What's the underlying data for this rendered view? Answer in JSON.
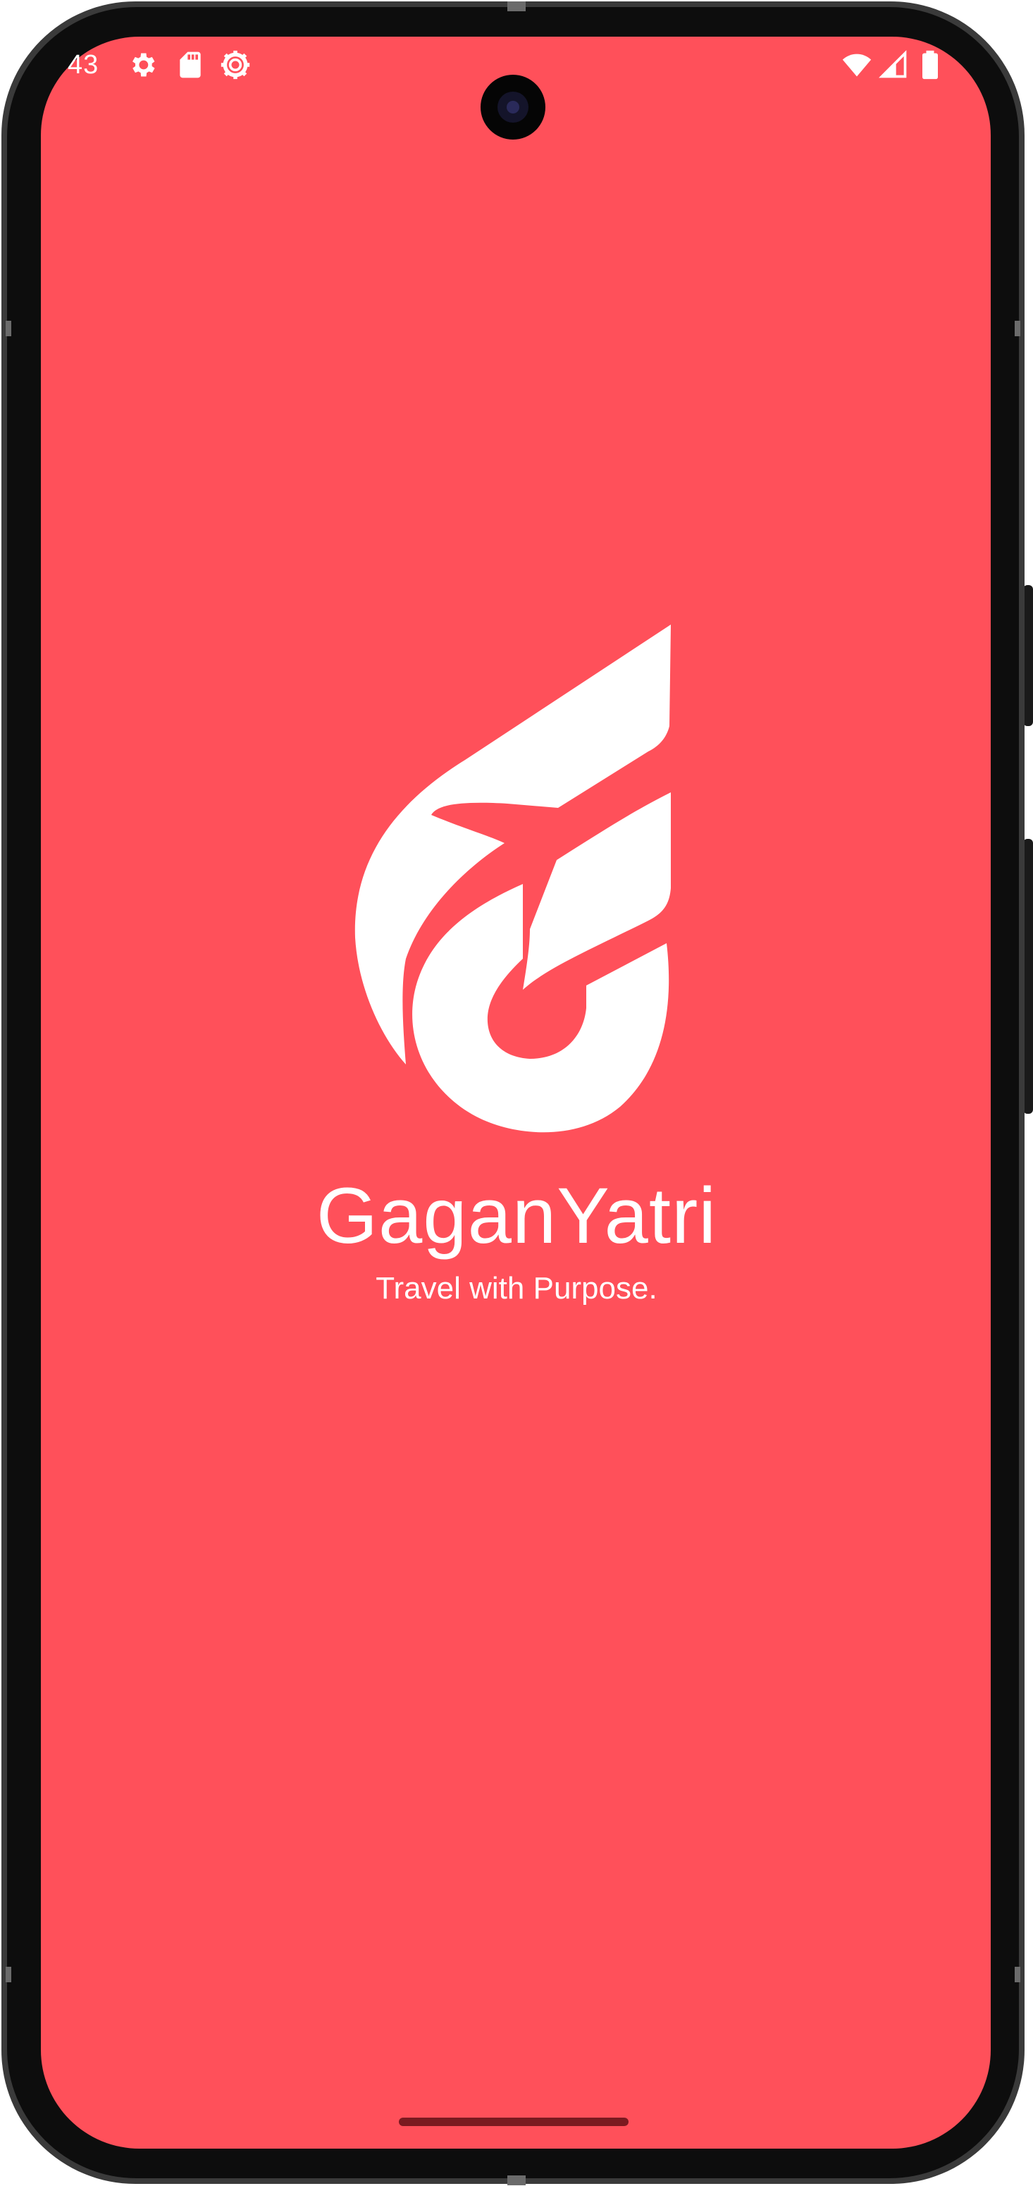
{
  "device": {
    "frame_color": "#0d0d0d",
    "bezel_color": "#2b2b2b"
  },
  "screen": {
    "background": "#ff505a"
  },
  "status_bar": {
    "time": "43",
    "icons": [
      "settings-icon",
      "sd-card-icon",
      "debug-gear-icon",
      "wifi-icon",
      "cell-signal-icon",
      "battery-icon"
    ]
  },
  "splash": {
    "app_name": "GaganYatri",
    "tagline": "Travel with Purpose.",
    "logo_icon": "gaganyatri-plane-logo-icon"
  },
  "navigation": {
    "gesture_bar": "home-gesture-handle",
    "gesture_bar_color": "#7a1a20"
  }
}
